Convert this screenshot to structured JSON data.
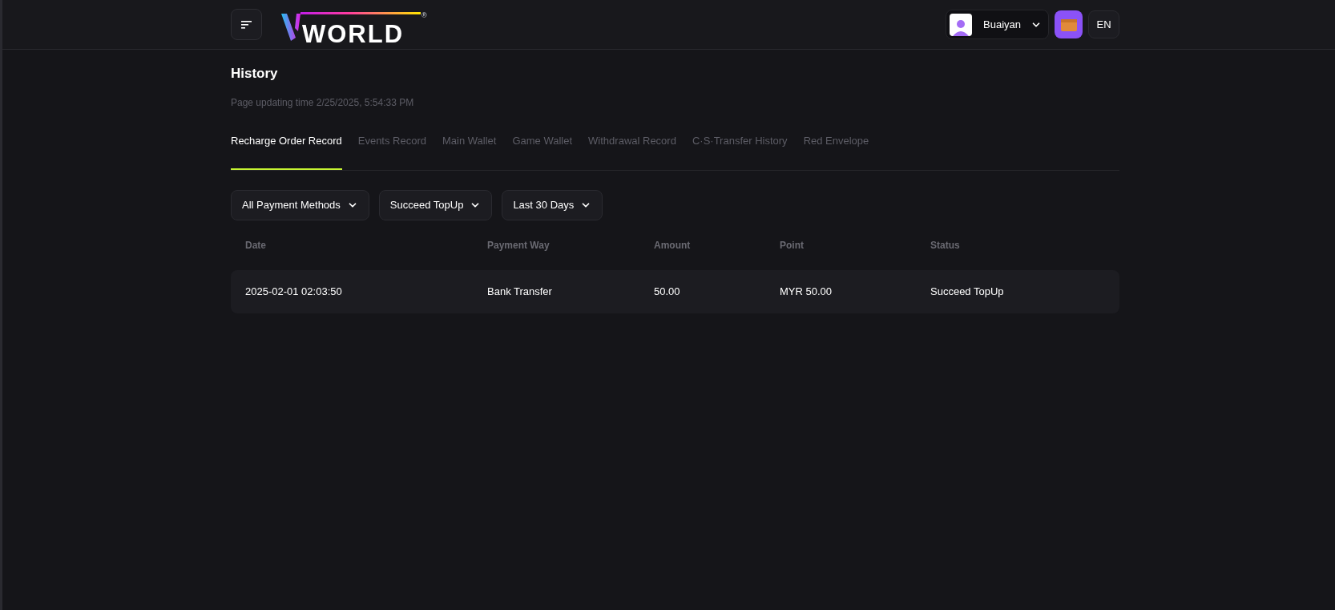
{
  "header": {
    "logo": {
      "text": "WORLD",
      "mark": "®"
    },
    "user": {
      "name": "Buaiyan"
    },
    "language": "EN"
  },
  "page": {
    "title": "History",
    "updated": "Page updating time 2/25/2025, 5:54:33 PM"
  },
  "tabs": [
    {
      "label": "Recharge Order Record",
      "selected": true
    },
    {
      "label": "Events Record",
      "selected": false
    },
    {
      "label": "Main Wallet",
      "selected": false
    },
    {
      "label": "Game Wallet",
      "selected": false
    },
    {
      "label": "Withdrawal Record",
      "selected": false
    },
    {
      "label": "C·S·Transfer History",
      "selected": false
    },
    {
      "label": "Red Envelope",
      "selected": false
    }
  ],
  "filters": [
    "All Payment Methods",
    "Succeed TopUp",
    "Last 30 Days"
  ],
  "table": {
    "columns": [
      "Date",
      "Payment Way",
      "Amount",
      "Point",
      "Status"
    ],
    "rows": [
      [
        "2025-02-01 02:03:50",
        "Bank Transfer",
        "50.00",
        "MYR 50.00",
        "Succeed TopUp"
      ]
    ]
  }
}
